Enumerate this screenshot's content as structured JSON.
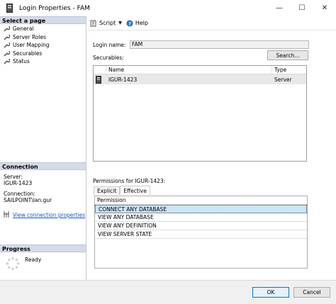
{
  "window": {
    "title": "Login Properties - FAM",
    "minimize_glyph": "—",
    "maximize_glyph": "☐",
    "close_glyph": "✕"
  },
  "left_pane": {
    "select_page_header": "Select a page",
    "pages": [
      {
        "label": "General",
        "icon": "wrench-icon"
      },
      {
        "label": "Server Roles",
        "icon": "wrench-icon"
      },
      {
        "label": "User Mapping",
        "icon": "wrench-icon"
      },
      {
        "label": "Securables",
        "icon": "wrench-icon"
      },
      {
        "label": "Status",
        "icon": "wrench-icon"
      }
    ],
    "connection_header": "Connection",
    "server_label": "Server:",
    "server_value": "IGUR-1423",
    "connection_label": "Connection:",
    "connection_value": "SAILPOINT\\lan.gur",
    "view_connection_link": "View connection properties",
    "progress_header": "Progress",
    "progress_status": "Ready"
  },
  "toolbar": {
    "script_label": "Script",
    "help_label": "Help"
  },
  "form": {
    "login_name_label": "Login name:",
    "login_name_value": "FAM",
    "securables_label": "Securables:",
    "search_button": "Search..."
  },
  "securables_grid": {
    "columns": [
      "",
      "Name",
      "Type"
    ],
    "rows": [
      {
        "name": "IGUR-1423",
        "type": "Server"
      }
    ]
  },
  "permissions": {
    "label": "Permissions for IGUR-1423:",
    "tabs": [
      "Explicit",
      "Effective"
    ],
    "active_tab": "Effective",
    "column_header": "Permission",
    "rows": [
      "CONNECT ANY DATABASE",
      "VIEW ANY DATABASE",
      "VIEW ANY DEFINITION",
      "VIEW SERVER STATE"
    ],
    "selected_index": 0
  },
  "footer": {
    "ok_button": "OK",
    "cancel_button": "Cancel"
  },
  "colors": {
    "section_header_bg": "#d6dbe9",
    "link": "#1a55c7",
    "selected_row": "#cce4f7",
    "ok_border": "#0078d7"
  }
}
